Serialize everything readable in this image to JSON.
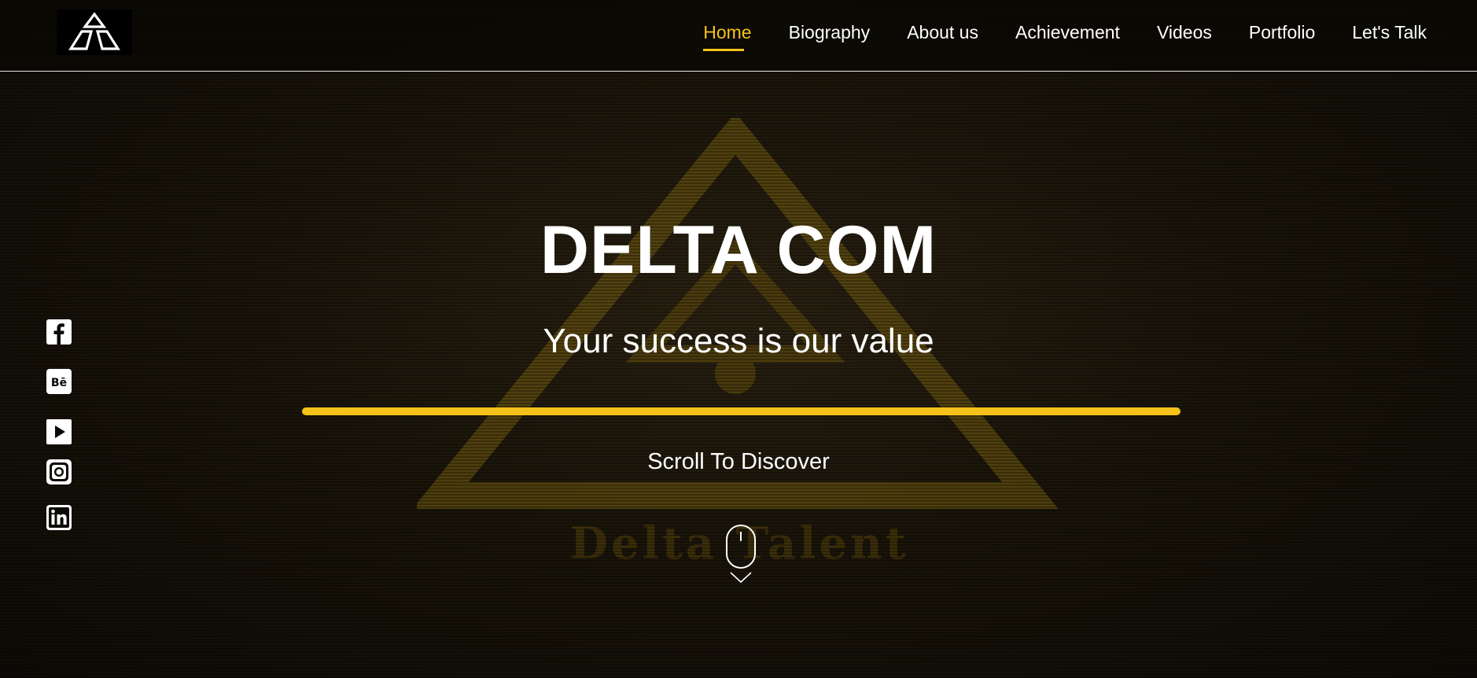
{
  "header": {
    "logo_icon": "delta-triangle-logo-icon",
    "nav": [
      {
        "label": "Home",
        "active": true
      },
      {
        "label": "Biography",
        "active": false
      },
      {
        "label": "About us",
        "active": false
      },
      {
        "label": "Achievement",
        "active": false
      },
      {
        "label": "Videos",
        "active": false
      },
      {
        "label": "Portfolio",
        "active": false
      },
      {
        "label": "Let's Talk",
        "active": false
      }
    ]
  },
  "social": [
    {
      "icon": "facebook-icon"
    },
    {
      "icon": "behance-icon"
    },
    {
      "icon": "youtube-icon"
    },
    {
      "icon": "instagram-icon"
    },
    {
      "icon": "linkedin-icon"
    }
  ],
  "hero": {
    "title": "DELTA COM",
    "subtitle": "Your success is our value",
    "scroll_label": "Scroll To Discover",
    "scroll_icon": "mouse-scroll-icon",
    "background_watermark": "Delta Talent"
  },
  "colors": {
    "accent": "#f4c21a",
    "background": "#1a150a",
    "text": "#ffffff"
  }
}
